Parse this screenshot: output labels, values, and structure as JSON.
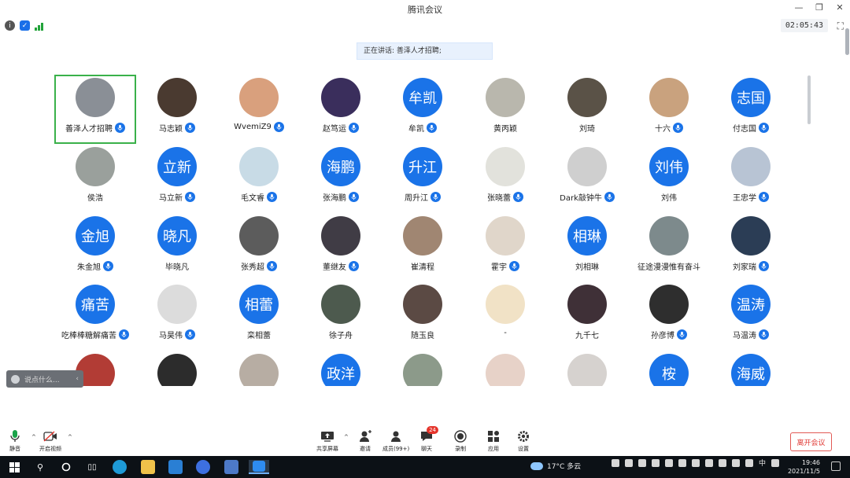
{
  "window": {
    "title": "腾讯会议",
    "timer": "02:05:43"
  },
  "speaking": {
    "text": "正在讲话: 善泽人才招聘;"
  },
  "participants": [
    {
      "name": "善泽人才招聘",
      "avatar_text": "",
      "avatar_color": "#8a8f96",
      "mic": true,
      "active": true
    },
    {
      "name": "马志颖",
      "avatar_text": "",
      "avatar_color": "#4a3a30",
      "mic": true
    },
    {
      "name": "WvemiZ9",
      "avatar_text": "",
      "avatar_color": "#d9a07d",
      "mic": true
    },
    {
      "name": "赵笃运",
      "avatar_text": "",
      "avatar_color": "#3a2e5c",
      "mic": true
    },
    {
      "name": "牟凯",
      "avatar_text": "牟凯",
      "mic": true
    },
    {
      "name": "黄丙颖",
      "avatar_text": "",
      "avatar_color": "#b9b7ad",
      "mic": false
    },
    {
      "name": "刘琦",
      "avatar_text": "",
      "avatar_color": "#5a5247",
      "mic": false
    },
    {
      "name": "十六",
      "avatar_text": "",
      "avatar_color": "#c9a27e",
      "mic": true
    },
    {
      "name": "付志国",
      "avatar_text": "志国",
      "mic": true
    },
    {
      "name": "侯浩",
      "avatar_text": "",
      "avatar_color": "#9aa09c",
      "mic": false
    },
    {
      "name": "马立新",
      "avatar_text": "立新",
      "mic": true
    },
    {
      "name": "毛文睿",
      "avatar_text": "",
      "avatar_color": "#c8dbe6",
      "mic": true
    },
    {
      "name": "张海鹏",
      "avatar_text": "海鹏",
      "mic": true
    },
    {
      "name": "周升江",
      "avatar_text": "升江",
      "mic": true
    },
    {
      "name": "张晓蕾",
      "avatar_text": "",
      "avatar_color": "#e2e2dc",
      "mic": true
    },
    {
      "name": "Dark敲钟牛",
      "avatar_text": "",
      "avatar_color": "#cfcfcf",
      "mic": true
    },
    {
      "name": "刘伟",
      "avatar_text": "刘伟",
      "mic": false
    },
    {
      "name": "王忠学",
      "avatar_text": "",
      "avatar_color": "#b8c4d4",
      "mic": true
    },
    {
      "name": "朱金旭",
      "avatar_text": "金旭",
      "mic": true
    },
    {
      "name": "毕晓凡",
      "avatar_text": "晓凡",
      "mic": false
    },
    {
      "name": "张秀超",
      "avatar_text": "",
      "avatar_color": "#5c5c5c",
      "mic": true
    },
    {
      "name": "董继友",
      "avatar_text": "",
      "avatar_color": "#403c45",
      "mic": true
    },
    {
      "name": "崔清程",
      "avatar_text": "",
      "avatar_color": "#a08672",
      "mic": false
    },
    {
      "name": "霍宇",
      "avatar_text": "",
      "avatar_color": "#e0d6ca",
      "mic": true
    },
    {
      "name": "刘相琳",
      "avatar_text": "相琳",
      "mic": false
    },
    {
      "name": "征途漫漫惟有奋斗",
      "avatar_text": "",
      "avatar_color": "#7d8a8c",
      "mic": false
    },
    {
      "name": "刘家瑞",
      "avatar_text": "",
      "avatar_color": "#2b3d55",
      "mic": true
    },
    {
      "name": "吃棒棒糖解痛苦",
      "avatar_text": "痛苦",
      "mic": true
    },
    {
      "name": "马昊伟",
      "avatar_text": "",
      "avatar_color": "#dcdcdc",
      "mic": true
    },
    {
      "name": "栾相蕾",
      "avatar_text": "相蕾",
      "mic": false
    },
    {
      "name": "徐子舟",
      "avatar_text": "",
      "avatar_color": "#4d5a4e",
      "mic": false
    },
    {
      "name": "随玉良",
      "avatar_text": "",
      "avatar_color": "#5b4a44",
      "mic": false
    },
    {
      "name": "-",
      "avatar_text": "",
      "avatar_color": "#f1e2c6",
      "mic": false
    },
    {
      "name": "九千七",
      "avatar_text": "",
      "avatar_color": "#3f3037",
      "mic": false
    },
    {
      "name": "孙彦博",
      "avatar_text": "",
      "avatar_color": "#2e2e2e",
      "mic": true
    },
    {
      "name": "马温涛",
      "avatar_text": "温涛",
      "mic": true
    },
    {
      "name": "",
      "avatar_text": "",
      "avatar_color": "#b23c35",
      "mic": false
    },
    {
      "name": "",
      "avatar_text": "",
      "avatar_color": "#2c2c2c",
      "mic": false
    },
    {
      "name": "",
      "avatar_text": "",
      "avatar_color": "#b7ada3",
      "mic": false
    },
    {
      "name": "",
      "avatar_text": "政洋",
      "mic": false
    },
    {
      "name": "",
      "avatar_text": "",
      "avatar_color": "#8c9a8a",
      "mic": false
    },
    {
      "name": "",
      "avatar_text": "",
      "avatar_color": "#e7d2c8",
      "mic": false
    },
    {
      "name": "",
      "avatar_text": "",
      "avatar_color": "#d6d2cf",
      "mic": false
    },
    {
      "name": "",
      "avatar_text": "桉",
      "mic": false
    },
    {
      "name": "",
      "avatar_text": "海威",
      "mic": false
    }
  ],
  "chat": {
    "placeholder": "说点什么..."
  },
  "toolbar": {
    "mute": "静音",
    "video": "开启视频",
    "share": "共享屏幕",
    "invite": "邀请",
    "members": "成员(99+)",
    "chat": "聊天",
    "chat_badge": "24",
    "record": "录制",
    "apps": "应用",
    "settings": "设置",
    "leave": "离开会议"
  },
  "taskbar": {
    "weather": "17°C 多云",
    "ime": "中",
    "time": "19:46",
    "date": "2021/11/5"
  },
  "colors": {
    "accent": "#1a73e8",
    "active_border": "#3ab14a",
    "leave": "#e03a35"
  }
}
